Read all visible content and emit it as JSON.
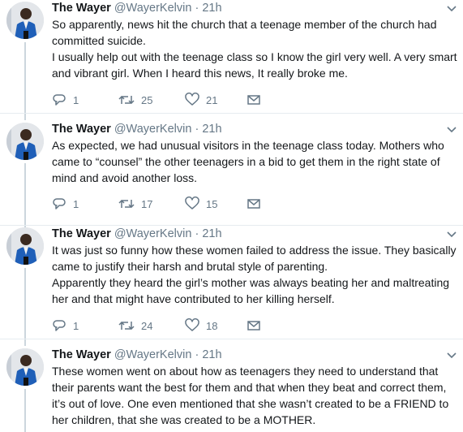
{
  "tweets": [
    {
      "name": "The Wayer",
      "handle": "@WayerKelvin",
      "dot": "·",
      "time": "21h",
      "paragraphs": [
        "So apparently, news hit the church that a teenage member of the church had committed suicide.",
        "I usually help out with the teenage class so I know the girl very well. A very smart and vibrant girl. When I heard this news, It really broke me."
      ],
      "replies": "1",
      "retweets": "25",
      "likes": "21"
    },
    {
      "name": "The Wayer",
      "handle": "@WayerKelvin",
      "dot": "·",
      "time": "21h",
      "paragraphs": [
        "As expected, we had unusual visitors in the teenage class today. Mothers who came to “counsel” the other teenagers in a bid to get them in the right state of mind and avoid another loss."
      ],
      "replies": "1",
      "retweets": "17",
      "likes": "15"
    },
    {
      "name": "The Wayer",
      "handle": "@WayerKelvin",
      "dot": "·",
      "time": "21h",
      "paragraphs": [
        "It was just so funny how these women failed to address the issue. They basically came to justify their harsh and brutal style of parenting.",
        "Apparently they heard the girl’s mother was always beating her and maltreating her and that might have contributed to her killing herself."
      ],
      "replies": "1",
      "retweets": "24",
      "likes": "18"
    },
    {
      "name": "The Wayer",
      "handle": "@WayerKelvin",
      "dot": "·",
      "time": "21h",
      "paragraphs": [
        "These women went on about how as teenagers they need to understand that their parents want the best for them and that when they beat and correct them, it’s out of love. One even mentioned that she wasn’t created to be a FRIEND to her children, that she was created to be a MOTHER."
      ]
    }
  ],
  "icons": {
    "reply": "reply-icon",
    "retweet": "retweet-icon",
    "like": "heart-icon",
    "message": "envelope-icon",
    "caret": "chevron-down-icon"
  },
  "colors": {
    "text": "#14171a",
    "secondary": "#657786",
    "rail": "#ccd6dd",
    "avatar_jacket": "#1f5fb8"
  }
}
